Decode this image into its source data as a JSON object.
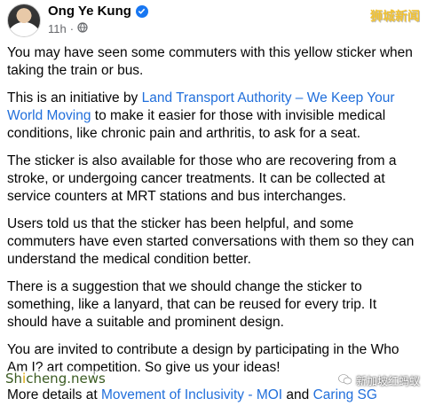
{
  "post": {
    "author": "Ong Ye Kung",
    "timestamp": "11h",
    "paragraphs": {
      "p1": "You may have seen some commuters with this yellow sticker when taking the train or bus.",
      "p2_before": "This is an initiative by ",
      "p2_link": "Land Transport Authority – We Keep Your World Moving",
      "p2_after": " to make it easier for those with invisible medical conditions, like chronic pain and arthritis, to ask for a seat.",
      "p3": "The sticker is also available for those who are recovering from a stroke, or undergoing cancer treatments. It can be collected at service counters at MRT stations and bus interchanges.",
      "p4": "Users told us that the sticker has been helpful, and some commuters have even started conversations with them so they can understand the medical condition better.",
      "p5": "There is a suggestion that we should change the sticker to something, like a lanyard, that can be reused for every trip. It should have a suitable and prominent design.",
      "p6": "You are invited to contribute a design by participating in the Who Am I? art competition. So give us your ideas!",
      "p7_before": "More details at ",
      "p7_link1": "Movement of Inclusivity - MOI",
      "p7_mid": " and ",
      "p7_link2": "Caring SG"
    }
  },
  "watermarks": {
    "top_right": "狮城新闻",
    "bottom_left_prefix": "Sh",
    "bottom_left_gold": "i",
    "bottom_left_suffix": "cheng.news",
    "bottom_right": "新加坡红蚂蚁"
  },
  "colors": {
    "link": "#216fdb",
    "verified": "#1877f2",
    "meta": "#65676b"
  },
  "icons": {
    "verified": "verified-badge-icon",
    "audience": "globe-icon",
    "wechat": "wechat-icon"
  }
}
